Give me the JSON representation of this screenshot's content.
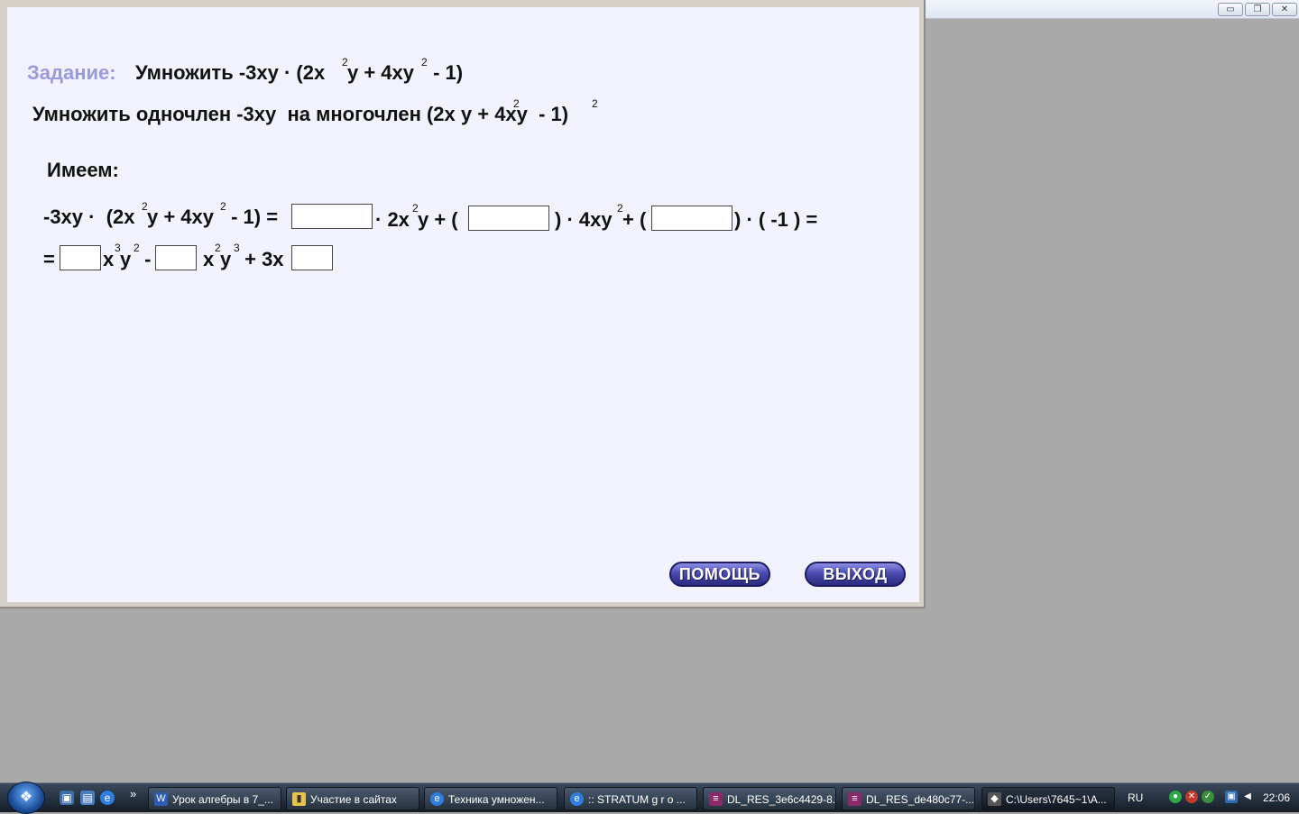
{
  "window": {
    "min_glyph": "▭",
    "max_glyph": "❐",
    "close_glyph": "✕"
  },
  "task": {
    "label": "Задание:",
    "text": "Умножить -3xy · (2x",
    "text_a": "y + 4xy",
    "text_b": " - 1)",
    "sup1": "2",
    "sup2": "2"
  },
  "subtitle": {
    "text": "Умножить одночлен -3xy  на многочлен (2x y + 4xy  - 1)",
    "sup1": "2",
    "sup2": "2"
  },
  "have_label": "Имеем:",
  "equation": {
    "line1_a": "-3xy ·  (2x",
    "line1_b": "y + 4xy",
    "line1_c": " - 1) =",
    "line1_d": "· 2x",
    "line1_e": "y + (",
    "line1_f": ") · 4xy",
    "line1_g": "+ (",
    "line1_h": ") · ( -1 ) =",
    "line2_a": "=",
    "line2_b": "x",
    "line2_c": "y",
    "line2_d": " -",
    "line2_e": "x",
    "line2_f": "y",
    "line2_g": " + 3x",
    "exp2": "2",
    "exp3": "3",
    "inputs_line1": [
      "",
      "",
      ""
    ],
    "inputs_line2": [
      "",
      "",
      ""
    ]
  },
  "buttons": {
    "help": "ПОМОЩЬ",
    "exit": "ВЫХОД"
  },
  "taskbar": {
    "items": [
      {
        "label": "Урок алгебры в 7_...",
        "icon": "word-icon"
      },
      {
        "label": "Участие в сайтах",
        "icon": "folder-icon"
      },
      {
        "label": "Техника умножен...",
        "icon": "ie-icon"
      },
      {
        "label": ":: STRATUM g r o ...",
        "icon": "ie-icon"
      },
      {
        "label": "DL_RES_3e6c4429-8...",
        "icon": "archive-icon"
      },
      {
        "label": "DL_RES_de480c77-...",
        "icon": "archive-icon"
      },
      {
        "label": "C:\\Users\\7645~1\\A...",
        "icon": "app-icon"
      }
    ],
    "chevron": "»",
    "lang": "RU",
    "clock": "22:06"
  }
}
